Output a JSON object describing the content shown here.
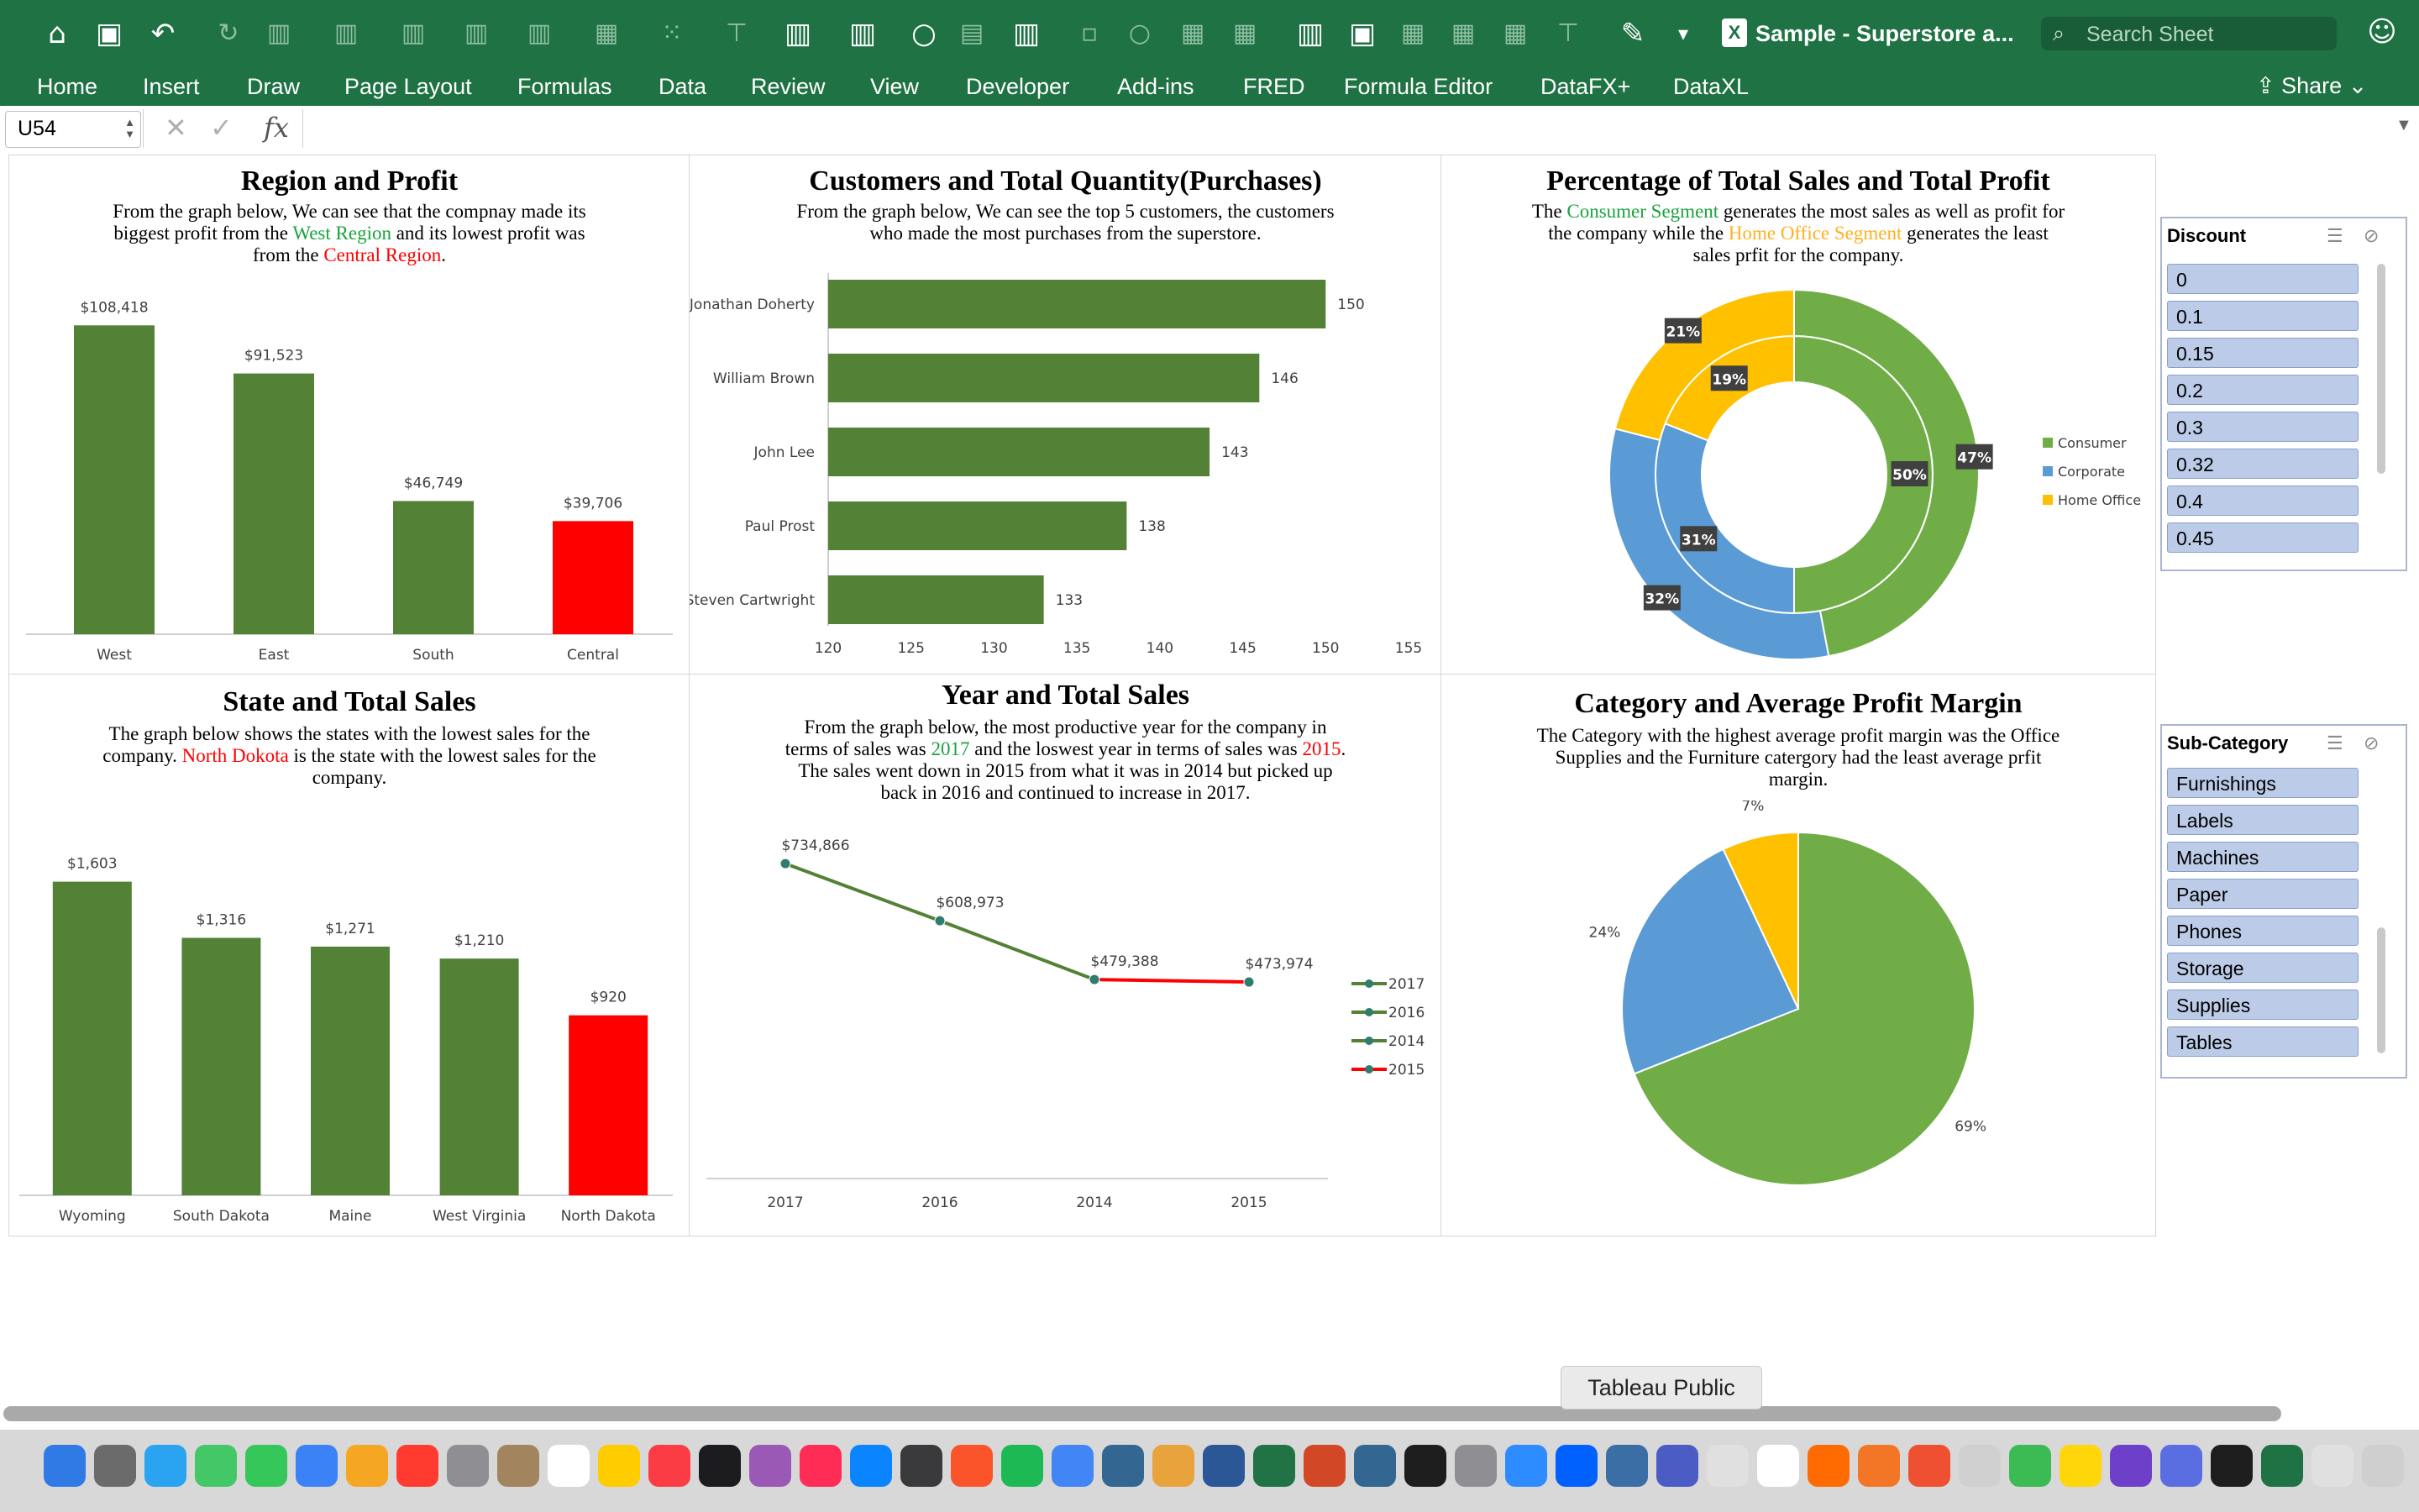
{
  "window": {
    "title": "Sample - Superstore a...",
    "search_placeholder": "Search Sheet",
    "share_label": "Share"
  },
  "ribbon_tabs": [
    "Home",
    "Insert",
    "Draw",
    "Page Layout",
    "Formulas",
    "Data",
    "Review",
    "View",
    "Developer",
    "Add-ins",
    "FRED",
    "Formula Editor",
    "DataFX+",
    "DataXL"
  ],
  "formula_bar": {
    "cell_ref": "U54",
    "fx_label": "fx",
    "value": ""
  },
  "colors": {
    "ribbon": "#1f7244",
    "green_bar": "#538135",
    "red_bar": "#ff0000",
    "donut_green": "#70ad47",
    "donut_blue": "#5b9bd5",
    "donut_orange": "#ffc000"
  },
  "panels": {
    "region": {
      "title": "Region and Profit",
      "desc": [
        "From the graph below, We can see that the compnay made its",
        "biggest profit from the ",
        "West Region",
        " and its lowest profit was",
        "from the ",
        "Central Region",
        "."
      ]
    },
    "customers": {
      "title": "Customers and Total Quantity(Purchases)",
      "desc1": "From the graph below, We can see the top 5 customers, the customers",
      "desc2": "who made the most purchases from the superstore."
    },
    "segment": {
      "title": "Percentage of Total Sales and Total Profit",
      "desc": [
        "The ",
        "Consumer Segment",
        " generates the most sales as well as profit  for",
        "the company while the ",
        "Home Office Segment",
        " generates the least",
        "sales prfit for the company."
      ]
    },
    "state": {
      "title": "State and Total Sales",
      "desc": [
        "The graph below shows the states with the lowest sales for the",
        "company. ",
        "North Dokota",
        " is the state with the lowest sales for the",
        "company."
      ]
    },
    "year": {
      "title": "Year and Total Sales",
      "desc": [
        "From the graph below, the most productive year for the company in",
        "terms of sales was ",
        "2017",
        " and the loswest year in terms of sales was ",
        "2015",
        ".",
        "The sales went down in 2015 from what it was in 2014 but picked up",
        "back in 2016 and continued to increase in 2017."
      ]
    },
    "category": {
      "title": "Category and Average Profit Margin",
      "desc1": "The Category with the highest average profit margin was the Office",
      "desc2": "Supplies and the Furniture catergory had the least average prfit",
      "desc3": "margin."
    }
  },
  "chart_data": [
    {
      "id": "region_profit",
      "type": "bar",
      "categories": [
        "West",
        "East",
        "South",
        "Central"
      ],
      "values": [
        108418,
        91523,
        46749,
        39706
      ],
      "labels": [
        "$108,418",
        "$91,523",
        "$46,749",
        "$39,706"
      ],
      "highlight": [
        "Central"
      ],
      "ylim": [
        0,
        115000
      ]
    },
    {
      "id": "customers_quantity",
      "type": "bar",
      "orientation": "horizontal",
      "categories": [
        "Jonathan Doherty",
        "William Brown",
        "John Lee",
        "Paul Prost",
        "Steven Cartwright"
      ],
      "values": [
        150,
        146,
        143,
        138,
        133
      ],
      "xlim": [
        120,
        155
      ],
      "xticks": [
        120,
        125,
        130,
        135,
        140,
        145,
        150,
        155
      ]
    },
    {
      "id": "segment_share",
      "type": "pie",
      "style": "double-donut",
      "categories": [
        "Consumer",
        "Corporate",
        "Home Office"
      ],
      "series": [
        {
          "values": [
            50,
            31,
            19
          ]
        },
        {
          "values": [
            47,
            32,
            21
          ]
        }
      ],
      "legend": "right"
    },
    {
      "id": "state_sales",
      "type": "bar",
      "categories": [
        "Wyoming",
        "South Dakota",
        "Maine",
        "West Virginia",
        "North Dakota"
      ],
      "values": [
        1603,
        1316,
        1271,
        1210,
        920
      ],
      "labels": [
        "$1,603",
        "$1,316",
        "$1,271",
        "$1,210",
        "$920"
      ],
      "highlight": [
        "North Dakota"
      ],
      "ylim": [
        0,
        1700
      ]
    },
    {
      "id": "year_sales",
      "type": "line",
      "categories": [
        "2017",
        "2016",
        "2014",
        "2015"
      ],
      "values": [
        734866,
        608973,
        479388,
        473974
      ],
      "labels": [
        "$734,866",
        "$608,973",
        "$479,388",
        "$473,974"
      ],
      "series": [
        {
          "name": "2017"
        },
        {
          "name": "2016"
        },
        {
          "name": "2014"
        },
        {
          "name": "2015"
        }
      ],
      "ylim": [
        0,
        800000
      ],
      "legend": "right"
    },
    {
      "id": "category_margin",
      "type": "pie",
      "values": [
        69,
        24,
        7
      ],
      "labels": [
        "69%",
        "24%",
        "7%"
      ]
    }
  ],
  "slicers": {
    "discount": {
      "title": "Discount",
      "items": [
        "0",
        "0.1",
        "0.15",
        "0.2",
        "0.3",
        "0.32",
        "0.4",
        "0.45"
      ]
    },
    "subcategory": {
      "title": "Sub-Category",
      "items": [
        "Furnishings",
        "Labels",
        "Machines",
        "Paper",
        "Phones",
        "Storage",
        "Supplies",
        "Tables"
      ]
    }
  },
  "tooltip": "Tableau Public"
}
